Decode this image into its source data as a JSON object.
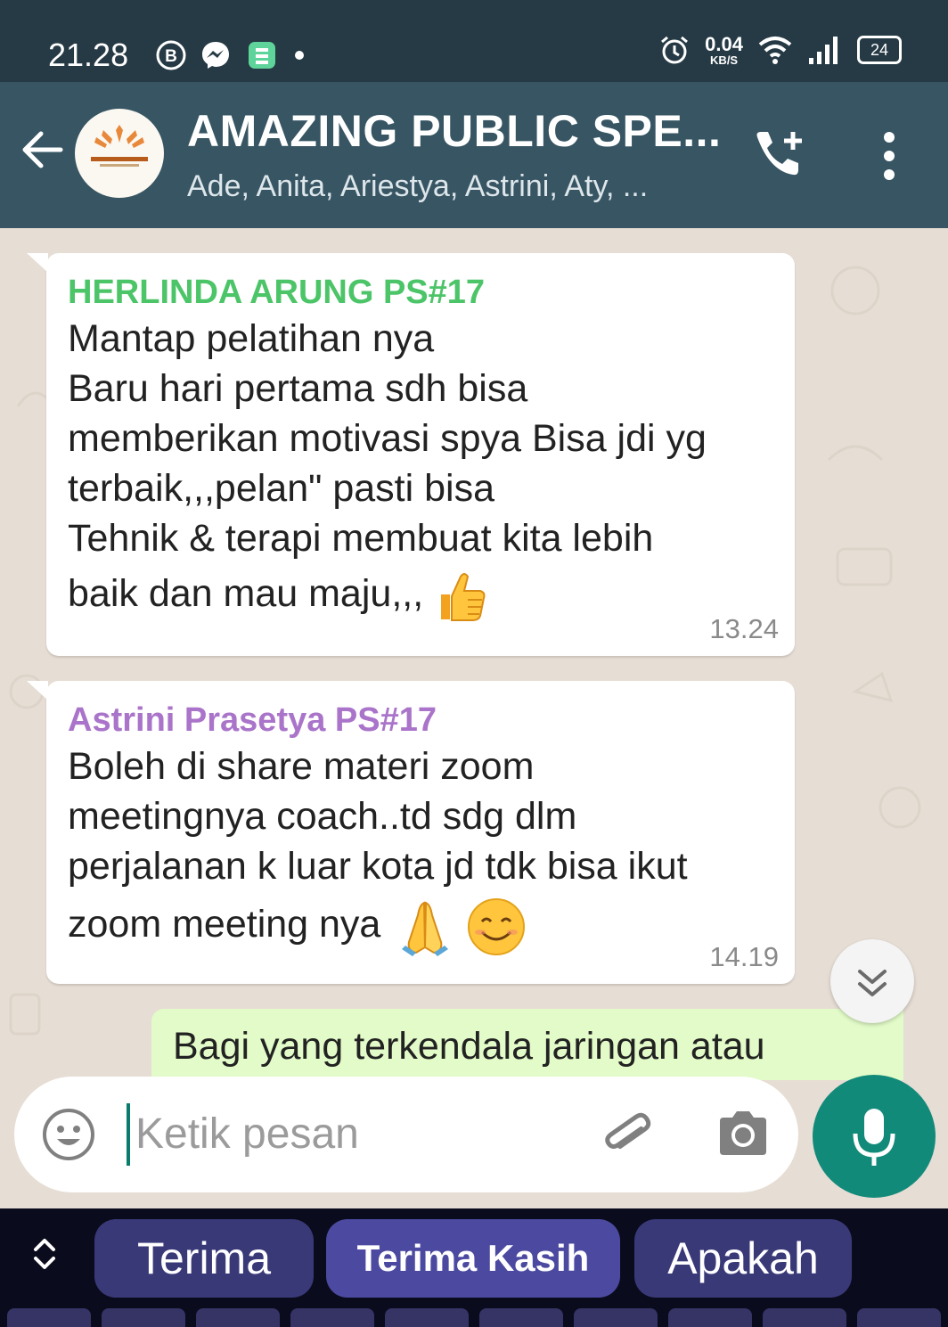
{
  "status_bar": {
    "time": "21.28",
    "left_icons": [
      "b-icon",
      "messenger-icon",
      "app-icon",
      "dot-icon"
    ],
    "net_speed_value": "0.04",
    "net_speed_unit": "KB/S",
    "battery": "24",
    "right_icons": [
      "alarm-icon",
      "wifi-icon",
      "signal-icon",
      "battery-icon"
    ]
  },
  "header": {
    "title": "AMAZING PUBLIC SPE...",
    "subtitle": "Ade, Anita, Ariestya, Astrini, Aty, ...",
    "icons": [
      "back-arrow-icon",
      "group-avatar",
      "add-call-icon",
      "more-vert-icon"
    ]
  },
  "messages": [
    {
      "sender": "HERLINDA ARUNG PS#17",
      "sender_color": "#4cc468",
      "lines": [
        "Mantap pelatihan nya",
        "Baru hari pertama sdh bisa",
        "memberikan motivasi spya Bisa jdi yg",
        "terbaik,,,pelan\" pasti bisa",
        "Tehnik & terapi membuat kita lebih",
        "baik dan mau maju,,,"
      ],
      "emoji": [
        "thumbs-up-emoji"
      ],
      "time": "13.24"
    },
    {
      "sender": "Astrini Prasetya PS#17",
      "sender_color": "#a974c9",
      "lines": [
        "Boleh di share materi zoom",
        "meetingnya coach..td sdg dlm",
        "perjalanan k luar kota jd tdk bisa ikut",
        "zoom meeting nya"
      ],
      "emoji": [
        "folded-hands-emoji",
        "smiling-face-emoji"
      ],
      "time": "14.19"
    }
  ],
  "outgoing_partial": {
    "text": "Bagi yang terkendala jaringan atau"
  },
  "composer": {
    "placeholder": "Ketik pesan",
    "value": "",
    "icons": [
      "emoji-icon",
      "attach-icon",
      "camera-icon",
      "mic-icon"
    ]
  },
  "keyboard": {
    "suggestions": [
      "Terima",
      "Terima Kasih",
      "Apakah"
    ],
    "icons": [
      "expand-collapse-icon"
    ]
  },
  "colors": {
    "status_bar": "#263a45",
    "app_bar": "#375563",
    "chat_bg": "#e6ddd4",
    "outgoing_bubble": "#e2fbc8",
    "accent": "#128a7a",
    "keyboard_bg": "#0b0b1e",
    "suggestion": "#3a3978"
  }
}
